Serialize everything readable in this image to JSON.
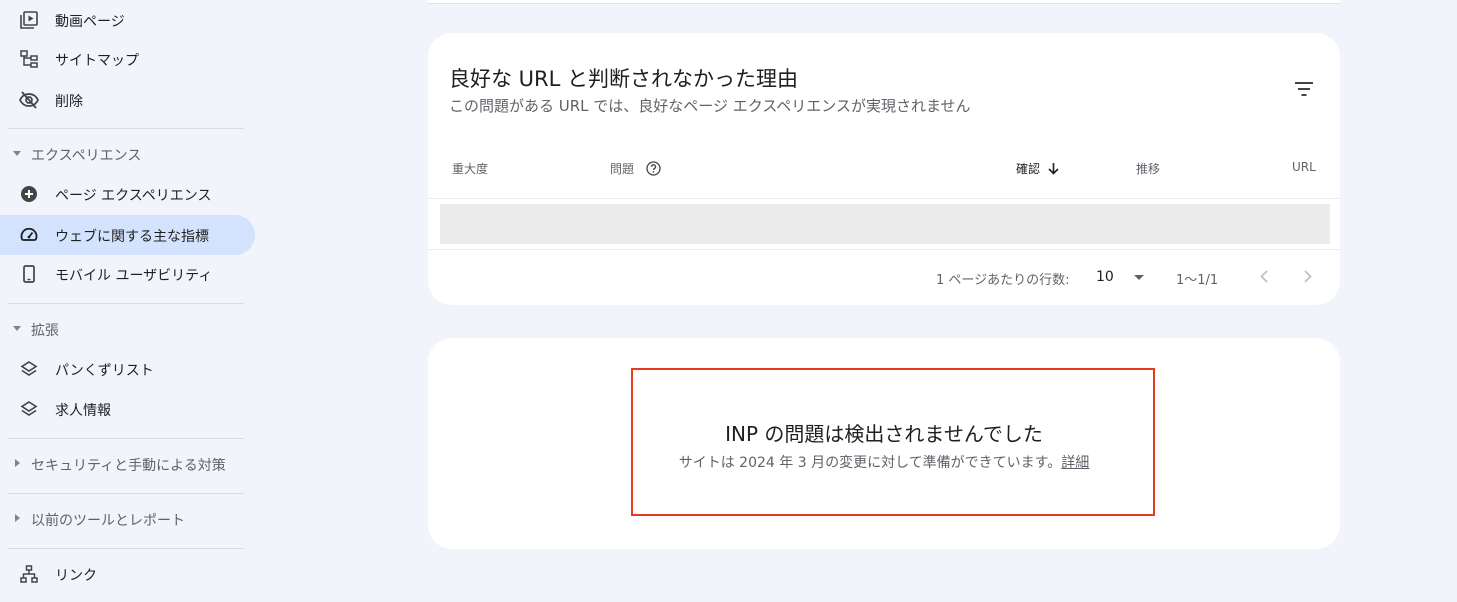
{
  "sidebar": {
    "items_top": [
      {
        "label": "動画ページ",
        "icon": "video-page-icon"
      },
      {
        "label": "サイトマップ",
        "icon": "sitemap-icon"
      },
      {
        "label": "削除",
        "icon": "eye-off-icon"
      }
    ],
    "sections": {
      "experience": {
        "header": "エクスペリエンス",
        "items": [
          {
            "label": "ページ エクスペリエンス",
            "icon": "plus-circle-icon"
          },
          {
            "label": "ウェブに関する主な指標",
            "icon": "speedometer-icon",
            "active": true
          },
          {
            "label": "モバイル ユーザビリティ",
            "icon": "phone-icon"
          }
        ]
      },
      "enhancements": {
        "header": "拡張",
        "items": [
          {
            "label": "パンくずリスト",
            "icon": "layers-icon"
          },
          {
            "label": "求人情報",
            "icon": "layers-icon"
          }
        ]
      },
      "security": {
        "header": "セキュリティと手動による対策"
      },
      "legacy": {
        "header": "以前のツールとレポート"
      }
    },
    "links_item": {
      "label": "リンク",
      "icon": "network-icon"
    }
  },
  "issues_card": {
    "title": "良好な URL と判断されなかった理由",
    "subtitle": "この問題がある URL では、良好なページ エクスペリエンスが実現されません",
    "columns": {
      "severity": "重大度",
      "issue": "問題",
      "validation": "確認",
      "trend": "推移",
      "url": "URL"
    },
    "pagination": {
      "rows_per_page_label": "1 ページあたりの行数:",
      "rows_per_page_value": "10",
      "range": "1〜1/1"
    }
  },
  "inp_card": {
    "title": "INP の問題は検出されませんでした",
    "subtitle": "サイトは 2024 年 3 月の変更に対して準備ができています。",
    "link": "詳細"
  },
  "colors": {
    "background": "#f1f4fb",
    "active_nav": "#d3e3fd",
    "highlight": "#e8391d"
  }
}
